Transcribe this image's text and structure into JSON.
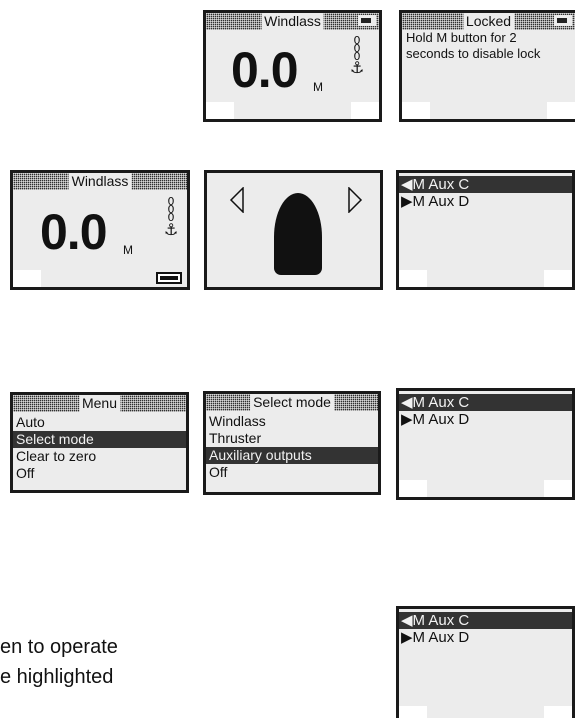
{
  "screen_a": {
    "title": "Windlass",
    "value": "0.0",
    "unit": "M"
  },
  "screen_b": {
    "title": "Locked",
    "message": "Hold M button for 2 seconds to disable lock"
  },
  "screen_c": {
    "title": "Windlass",
    "value": "0.0",
    "unit": "M"
  },
  "aux_list_1": {
    "items": [
      {
        "label": "M Aux C",
        "glyph": "◀",
        "selected": true
      },
      {
        "label": "M Aux D",
        "glyph": "▶",
        "selected": false
      }
    ]
  },
  "menu": {
    "title": "Menu",
    "items": [
      "Auto",
      "Select mode",
      "Clear to zero",
      "Off"
    ],
    "selected_index": 1
  },
  "select_mode": {
    "title": "Select mode",
    "items": [
      "Windlass",
      "Thruster",
      "Auxiliary outputs",
      "Off"
    ],
    "selected_index": 2
  },
  "aux_list_2": {
    "items": [
      {
        "label": "M Aux C",
        "glyph": "◀",
        "selected": true
      },
      {
        "label": "M Aux D",
        "glyph": "▶",
        "selected": false
      }
    ]
  },
  "aux_list_3": {
    "items": [
      {
        "label": "M Aux C",
        "glyph": "◀",
        "selected": true
      },
      {
        "label": "M Aux D",
        "glyph": "▶",
        "selected": false
      }
    ]
  },
  "caption": {
    "line1": "en to operate",
    "line2": "e highlighted"
  },
  "icons": {
    "chain": "chain-icon",
    "anchor": "anchor-icon",
    "lock": "lock-icon",
    "battery": "battery-icon",
    "left_arrow": "left-arrow-icon",
    "right_arrow": "right-arrow-icon",
    "hull": "boat-hull-icon"
  }
}
